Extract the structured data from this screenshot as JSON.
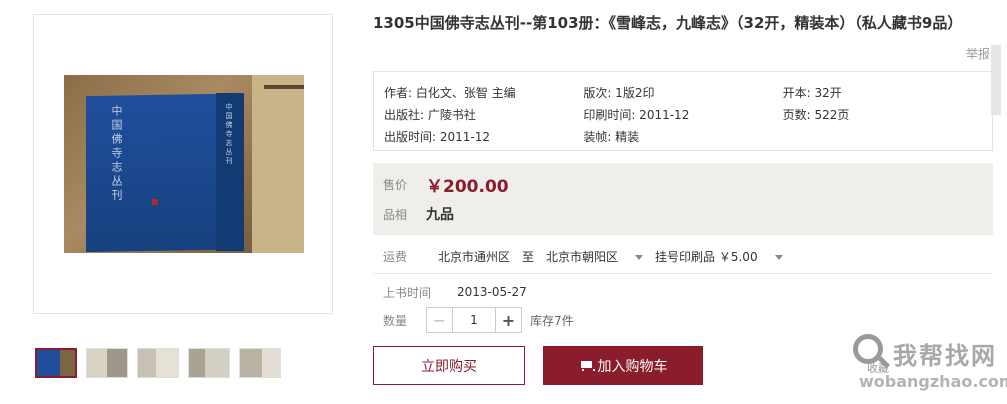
{
  "product": {
    "title": "1305中国佛寺志丛刊--第103册：《雪峰志，九峰志》（32开，精装本）（私人藏书9品）",
    "report_label": "举报",
    "book_cover_text": "中国佛寺志丛刊",
    "book_spine_text": "中国佛寺志丛刊"
  },
  "specs": {
    "rows": [
      [
        "作者: 白化文、张智 主编",
        "版次: 1版2印",
        "开本: 32开"
      ],
      [
        "出版社: 广陵书社",
        "印刷时间: 2011-12",
        "页数: 522页"
      ],
      [
        "出版时间: 2011-12",
        "装帧: 精装",
        ""
      ]
    ]
  },
  "price": {
    "label": "售价",
    "value": "￥200.00",
    "grade_label": "品相",
    "grade_value": "九品"
  },
  "shipping": {
    "label": "运费",
    "from": "北京市通州区",
    "to_label": "至",
    "to": "北京市朝阳区",
    "method": "挂号印刷品 ￥5.00"
  },
  "listing": {
    "uptime_label": "上书时间",
    "uptime_value": "2013-05-27",
    "qty_label": "数量",
    "qty_value": "1",
    "minus": "−",
    "plus": "+",
    "stock": "库存7件"
  },
  "actions": {
    "buy_now": "立即购买",
    "add_cart": "加入购物车"
  },
  "watermark": {
    "cn": "我帮找网",
    "en": "wobangzhao.com",
    "fav": "收藏"
  },
  "colors": {
    "accent": "#8a1c2b",
    "price_bg": "#f0eeea"
  }
}
